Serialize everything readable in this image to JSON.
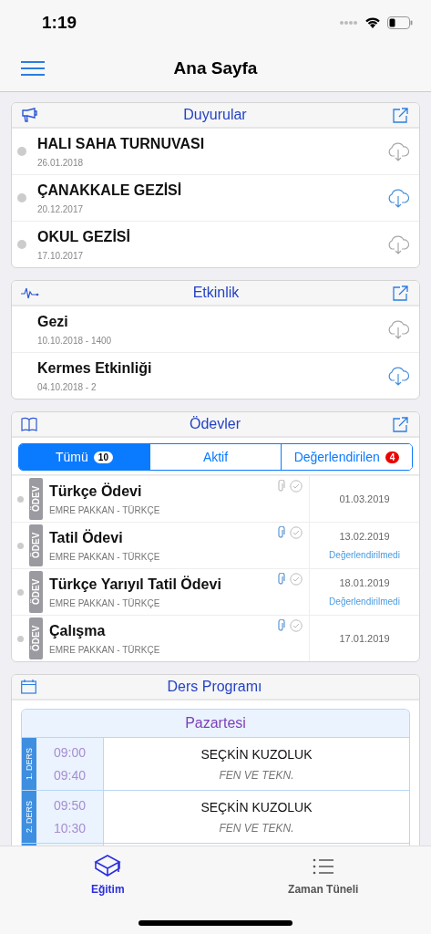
{
  "status_bar": {
    "time": "1:19"
  },
  "header": {
    "title": "Ana Sayfa"
  },
  "announcements": {
    "title": "Duyurular",
    "items": [
      {
        "title": "HALI SAHA TURNUVASI",
        "date": "26.01.2018",
        "downloaded": false
      },
      {
        "title": "ÇANAKKALE GEZİSİ",
        "date": "20.12.2017",
        "downloaded": true
      },
      {
        "title": "OKUL GEZİSİ",
        "date": "17.10.2017",
        "downloaded": false
      }
    ]
  },
  "events": {
    "title": "Etkinlik",
    "items": [
      {
        "title": "Gezi",
        "date": "10.10.2018 - 1400",
        "downloaded": false
      },
      {
        "title": "Kermes Etkinliği",
        "date": "04.10.2018 - 2",
        "downloaded": true
      }
    ]
  },
  "homework": {
    "title": "Ödevler",
    "tabs": [
      {
        "label": "Tümü",
        "badge": "10",
        "selected": true
      },
      {
        "label": "Aktif",
        "selected": false
      },
      {
        "label": "Değerlendirilen",
        "badge": "4",
        "selected": false
      }
    ],
    "items": [
      {
        "tag": "ÖDEV",
        "title": "Türkçe Ödevi",
        "teacher": "EMRE PAKKAN - TÜRKÇE",
        "date": "01.03.2019",
        "attachment": false
      },
      {
        "tag": "ÖDEV",
        "title": "Tatil Ödevi",
        "teacher": "EMRE PAKKAN - TÜRKÇE",
        "date": "13.02.2019",
        "status": "Değerlendirilmedi",
        "attachment": true
      },
      {
        "tag": "ÖDEV",
        "title": "Türkçe Yarıyıl Tatil Ödevi",
        "teacher": "EMRE PAKKAN - TÜRKÇE",
        "date": "18.01.2019",
        "status": "Değerlendirilmedi",
        "attachment": true
      },
      {
        "tag": "ÖDEV",
        "title": "Çalışma",
        "teacher": "EMRE PAKKAN - TÜRKÇE",
        "date": "17.01.2019",
        "attachment": true
      }
    ]
  },
  "schedule": {
    "title": "Ders Programı",
    "day": "Pazartesi",
    "lessons": [
      {
        "label": "1. DERS",
        "start": "09:00",
        "end": "09:40",
        "teacher": "SEÇKİN KUZOLUK",
        "subject": "FEN VE TEKN."
      },
      {
        "label": "2. DERS",
        "start": "09:50",
        "end": "10:30",
        "teacher": "SEÇKİN KUZOLUK",
        "subject": "FEN VE TEKN."
      }
    ]
  },
  "tab_bar": [
    {
      "label": "Eğitim",
      "selected": true
    },
    {
      "label": "Zaman Tüneli",
      "selected": false
    }
  ]
}
